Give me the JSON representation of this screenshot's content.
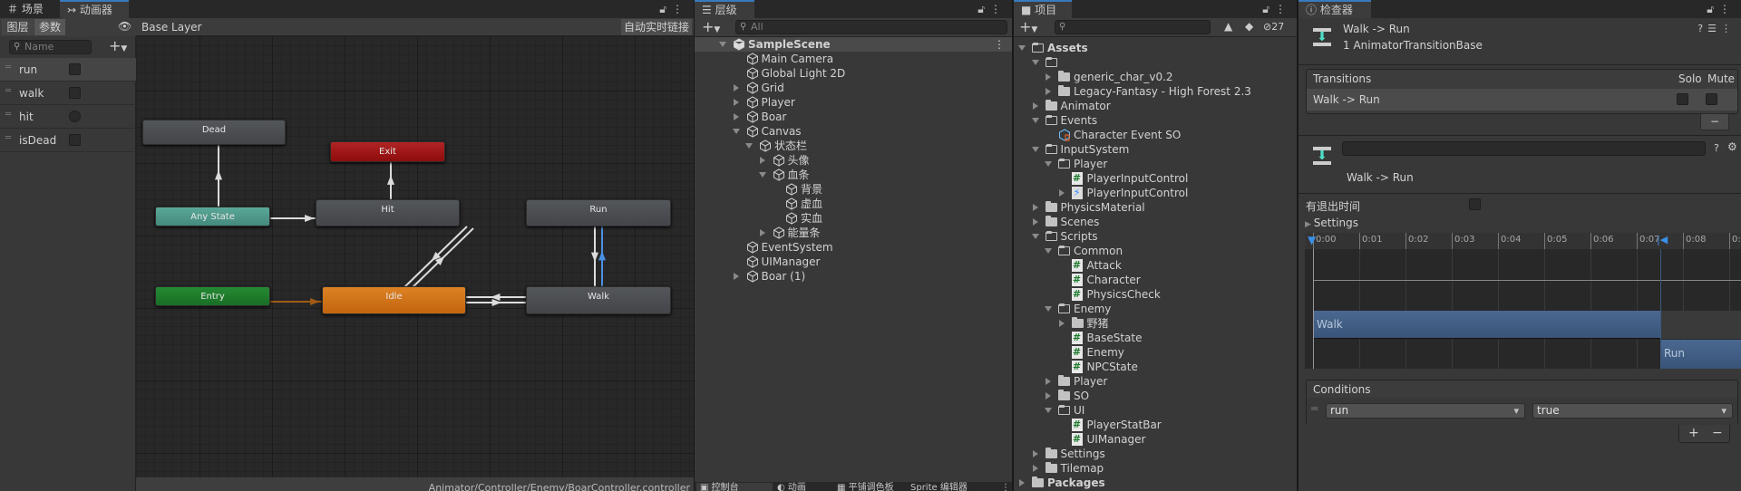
{
  "animator": {
    "tabs": [
      {
        "label": "场景",
        "icon": "grid-icon"
      },
      {
        "label": "动画器",
        "icon": "animator-icon",
        "active": true
      }
    ],
    "layers_tab": "图层",
    "params_tab": "参数",
    "breadcrumb": "Base Layer",
    "auto_live_link": "自动实时链接",
    "param_search_placeholder": "Name",
    "parameters": [
      {
        "name": "run",
        "type": "bool",
        "value": false
      },
      {
        "name": "walk",
        "type": "bool",
        "value": false
      },
      {
        "name": "hit",
        "type": "trigger",
        "value": false
      },
      {
        "name": "isDead",
        "type": "bool",
        "value": false
      }
    ],
    "states": {
      "dead": "Dead",
      "exit": "Exit",
      "any": "Any State",
      "hit": "Hit",
      "run": "Run",
      "entry": "Entry",
      "idle": "Idle",
      "walk": "Walk"
    },
    "colors": {
      "default": "#4a4c50",
      "exit": "#a01616",
      "any_state": "#4e9a8c",
      "entry": "#1d7a2b",
      "default_state": "#d0731a",
      "selected_transition": "#4a90e2"
    },
    "status_path": "Animator/Controller/Enemy/BoarController.controller"
  },
  "hierarchy": {
    "tab": "层级",
    "search_placeholder": "All",
    "items": [
      {
        "label": "SampleScene",
        "level": 0,
        "expand": "open",
        "bold": true,
        "icon": "unity-scene-icon"
      },
      {
        "label": "Main Camera",
        "level": 1
      },
      {
        "label": "Global Light 2D",
        "level": 1
      },
      {
        "label": "Grid",
        "level": 1,
        "expand": "closed"
      },
      {
        "label": "Player",
        "level": 1,
        "expand": "closed"
      },
      {
        "label": "Boar",
        "level": 1,
        "expand": "closed"
      },
      {
        "label": "Canvas",
        "level": 1,
        "expand": "open"
      },
      {
        "label": "状态栏",
        "level": 2,
        "expand": "open"
      },
      {
        "label": "头像",
        "level": 3,
        "expand": "closed"
      },
      {
        "label": "血条",
        "level": 3,
        "expand": "open"
      },
      {
        "label": "背景",
        "level": 4
      },
      {
        "label": "虚血",
        "level": 4
      },
      {
        "label": "实血",
        "level": 4
      },
      {
        "label": "能量条",
        "level": 3,
        "expand": "closed"
      },
      {
        "label": "EventSystem",
        "level": 1
      },
      {
        "label": "UIManager",
        "level": 1
      },
      {
        "label": "Boar (1)",
        "level": 1,
        "expand": "closed"
      }
    ],
    "bottom_tabs": [
      "控制台",
      "动画",
      "平铺调色板",
      "Sprite 编辑器"
    ]
  },
  "project": {
    "tab": "项目",
    "hidden_count": "27",
    "items": [
      {
        "label": "Assets",
        "level": 0,
        "expand": "open",
        "type": "folder",
        "bold": true
      },
      {
        "label": "",
        "level": 1,
        "expand": "open",
        "type": "folder"
      },
      {
        "label": "generic_char_v0.2",
        "level": 2,
        "expand": "closed",
        "type": "folder"
      },
      {
        "label": "Legacy-Fantasy - High Forest 2.3",
        "level": 2,
        "expand": "closed",
        "type": "folder"
      },
      {
        "label": "Animator",
        "level": 1,
        "expand": "closed",
        "type": "folder"
      },
      {
        "label": "Events",
        "level": 1,
        "expand": "open",
        "type": "folder"
      },
      {
        "label": "Character Event SO",
        "level": 2,
        "type": "so"
      },
      {
        "label": "InputSystem",
        "level": 1,
        "expand": "open",
        "type": "folder"
      },
      {
        "label": "Player",
        "level": 2,
        "expand": "open",
        "type": "folder"
      },
      {
        "label": "PlayerInputControl",
        "level": 3,
        "type": "script"
      },
      {
        "label": "PlayerInputControl",
        "level": 3,
        "expand": "closed",
        "type": "input"
      },
      {
        "label": "PhysicsMaterial",
        "level": 1,
        "expand": "closed",
        "type": "folder"
      },
      {
        "label": "Scenes",
        "level": 1,
        "expand": "closed",
        "type": "folder"
      },
      {
        "label": "Scripts",
        "level": 1,
        "expand": "open",
        "type": "folder"
      },
      {
        "label": "Common",
        "level": 2,
        "expand": "open",
        "type": "folder"
      },
      {
        "label": "Attack",
        "level": 3,
        "type": "script"
      },
      {
        "label": "Character",
        "level": 3,
        "type": "script"
      },
      {
        "label": "PhysicsCheck",
        "level": 3,
        "type": "script"
      },
      {
        "label": "Enemy",
        "level": 2,
        "expand": "open",
        "type": "folder"
      },
      {
        "label": "野猪",
        "level": 3,
        "expand": "closed",
        "type": "folder"
      },
      {
        "label": "BaseState",
        "level": 3,
        "type": "script"
      },
      {
        "label": "Enemy",
        "level": 3,
        "type": "script"
      },
      {
        "label": "NPCState",
        "level": 3,
        "type": "script"
      },
      {
        "label": "Player",
        "level": 2,
        "expand": "closed",
        "type": "folder"
      },
      {
        "label": "SO",
        "level": 2,
        "expand": "closed",
        "type": "folder"
      },
      {
        "label": "UI",
        "level": 2,
        "expand": "open",
        "type": "folder"
      },
      {
        "label": "PlayerStatBar",
        "level": 3,
        "type": "script"
      },
      {
        "label": "UIManager",
        "level": 3,
        "type": "script"
      },
      {
        "label": "Settings",
        "level": 1,
        "expand": "closed",
        "type": "folder"
      },
      {
        "label": "Tilemap",
        "level": 1,
        "expand": "closed",
        "type": "folder"
      },
      {
        "label": "Packages",
        "level": 0,
        "expand": "closed",
        "type": "folder",
        "bold": true
      }
    ]
  },
  "inspector": {
    "tab": "检查器",
    "title": "Walk -> Run",
    "subtitle": "1 AnimatorTransitionBase",
    "transitions_header": "Transitions",
    "solo": "Solo",
    "mute": "Mute",
    "transition_row": "Walk -> Run",
    "name_field": "",
    "transition_label": "Walk -> Run",
    "has_exit_time_label": "有退出时间",
    "has_exit_time": false,
    "settings_label": "Settings",
    "timeline": {
      "ticks": [
        "0:00",
        "0:01",
        "0:02",
        "0:03",
        "0:04",
        "0:05",
        "0:06",
        "0:07",
        "0:08",
        "0:"
      ],
      "from_clip": "Walk",
      "to_clip": "Run"
    },
    "conditions_header": "Conditions",
    "condition": {
      "parameter": "run",
      "value": "true"
    }
  }
}
